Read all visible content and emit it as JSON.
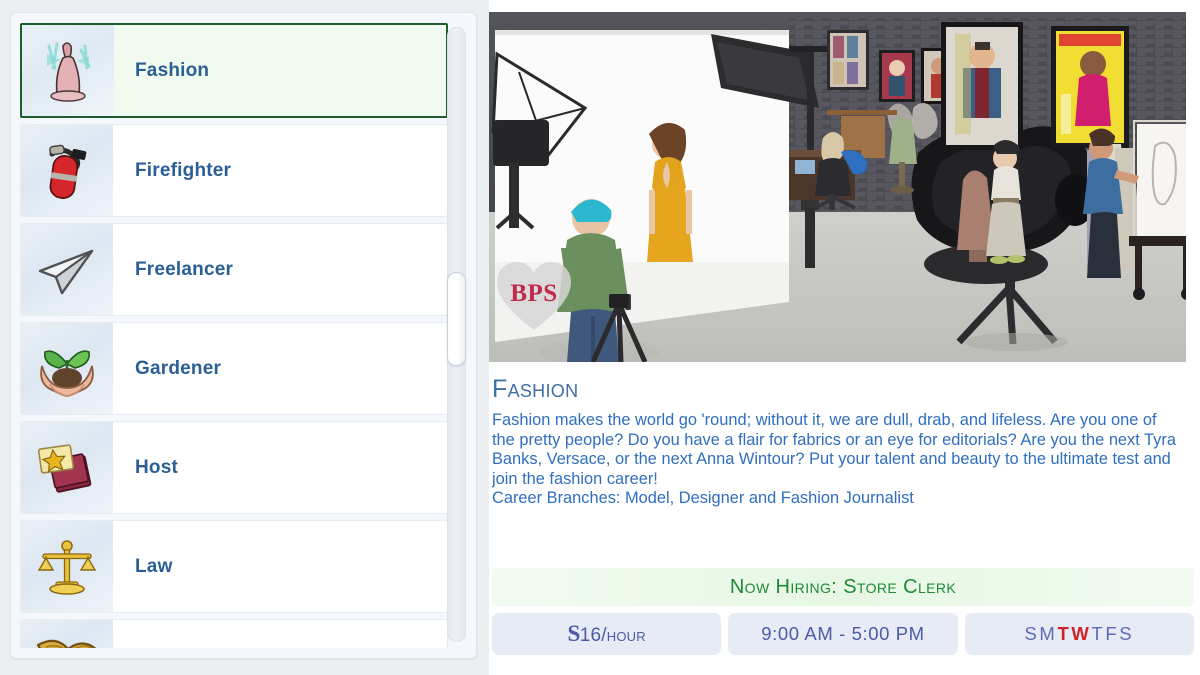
{
  "theme": {
    "accent_blue": "#2b5e95",
    "desc_blue": "#2f6fbf",
    "selected_border_green": "#1d5c2b",
    "selected_bg_green": "#f0faee",
    "hiring_green": "#1e8a36",
    "pill_bg": "#e6ebf5",
    "pill_text": "#4b5ba8",
    "workday_on": "#d0212a",
    "watermark_red": "#c0294a"
  },
  "career_list": {
    "selected_index": 0,
    "items": [
      {
        "label": "Fashion",
        "icon": "dress-icon",
        "selected": true
      },
      {
        "label": "Firefighter",
        "icon": "fire-extinguisher-icon",
        "selected": false
      },
      {
        "label": "Freelancer",
        "icon": "paper-plane-icon",
        "selected": false
      },
      {
        "label": "Gardener",
        "icon": "hands-seedling-icon",
        "selected": false
      },
      {
        "label": "Host",
        "icon": "star-book-icon",
        "selected": false
      },
      {
        "label": "Law",
        "icon": "scales-icon",
        "selected": false
      },
      {
        "label": "",
        "icon": "gold-wings-icon",
        "selected": false
      }
    ]
  },
  "scrollbar": {
    "name": "career-list-scrollbar"
  },
  "scene": {
    "name": "career-preview-image",
    "description": "Sims photo studio with models, lighting rigs, magazine posters and a sketch easel",
    "watermark": "BPS"
  },
  "detail": {
    "title": "Fashion",
    "description": "Fashion makes the world go 'round; without it, we are dull, drab, and lifeless. Are you one of the pretty people? Do you have a flair for fabrics or an eye for editorials?  Are you the next Tyra Banks, Versace, or the next Anna Wintour? Put your talent and beauty to the ultimate test and join the fashion career!",
    "branches": "Career Branches: Model, Designer and Fashion Journalist"
  },
  "hiring": {
    "banner": "Now Hiring: Store Clerk",
    "wage_symbol": "S",
    "wage_amount": "16",
    "wage_unit": "/hour",
    "hours": "9:00 AM - 5:00 PM",
    "days": [
      {
        "letter": "S",
        "working": false
      },
      {
        "letter": "M",
        "working": false
      },
      {
        "letter": "T",
        "working": true
      },
      {
        "letter": "W",
        "working": true
      },
      {
        "letter": "T",
        "working": false
      },
      {
        "letter": "F",
        "working": false
      },
      {
        "letter": "S",
        "working": false
      }
    ]
  }
}
